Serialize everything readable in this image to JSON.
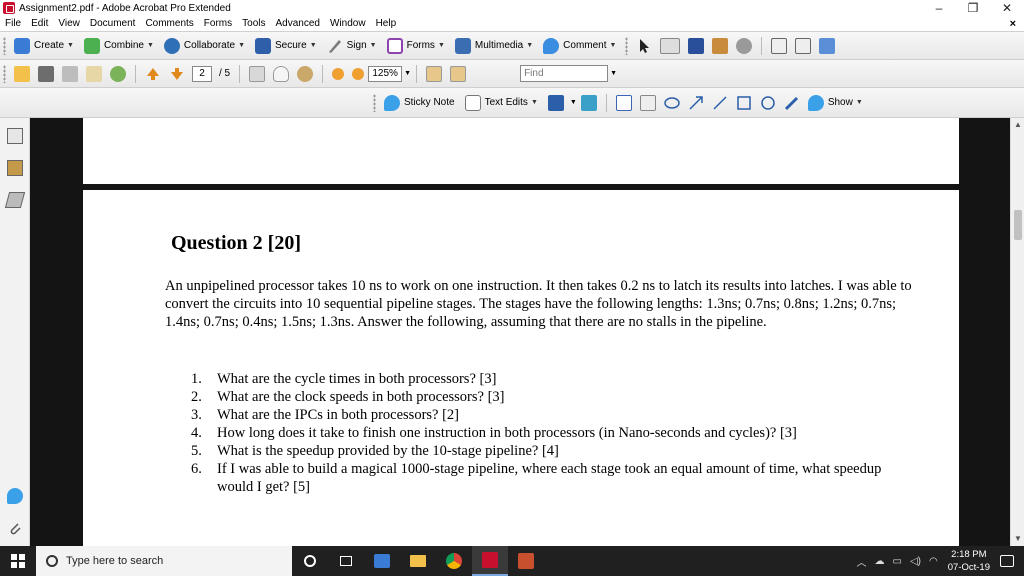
{
  "window": {
    "title": "Assignment2.pdf - Adobe Acrobat Pro Extended",
    "minimize": "–",
    "maximize": "❐",
    "close": "✕"
  },
  "menu": {
    "items": [
      "File",
      "Edit",
      "View",
      "Document",
      "Comments",
      "Forms",
      "Tools",
      "Advanced",
      "Window",
      "Help"
    ],
    "close": "×"
  },
  "toolbar1": {
    "create": "Create",
    "combine": "Combine",
    "collaborate": "Collaborate",
    "secure": "Secure",
    "sign": "Sign",
    "forms": "Forms",
    "multimedia": "Multimedia",
    "comment": "Comment"
  },
  "toolbar2": {
    "page_current": "2",
    "page_total": "/ 5",
    "zoom": "125%",
    "find_placeholder": "Find"
  },
  "toolbar3": {
    "sticky_note": "Sticky Note",
    "text_edits": "Text Edits",
    "show": "Show"
  },
  "document": {
    "question_title": "Question 2 [20]",
    "paragraph": "An unpipelined processor takes 10 ns to work on one instruction. It then takes 0.2 ns to latch its results into latches. I was able to convert the circuits into 10 sequential pipeline stages. The stages have the following lengths: 1.3ns; 0.7ns; 0.8ns; 1.2ns; 0.7ns; 1.4ns; 0.7ns; 0.4ns; 1.5ns; 1.3ns. Answer the following, assuming that there are no stalls in the pipeline.",
    "questions": [
      {
        "num": "1.",
        "text": "What are the cycle times in both processors?   [3]"
      },
      {
        "num": "2.",
        "text": "What are the clock speeds in both processors?  [3]"
      },
      {
        "num": "3.",
        "text": "What are the IPCs in both processors?   [2]"
      },
      {
        "num": "4.",
        "text": "How long does it take to finish one instruction in both processors (in Nano-seconds and cycles)?  [3]"
      },
      {
        "num": "5.",
        "text": "What is the speedup provided by the 10-stage pipeline?  [4]"
      },
      {
        "num": "6.",
        "text": "If I was able to build a magical 1000-stage pipeline, where each stage took an equal amount of time, what speedup would I get?  [5]"
      }
    ]
  },
  "taskbar": {
    "search_placeholder": "Type here to search",
    "time": "2:18 PM",
    "date": "07-Oct-19"
  },
  "colors": {
    "acrobat_red": "#c8102e",
    "doc_background": "#141414",
    "taskbar": "#202020"
  }
}
